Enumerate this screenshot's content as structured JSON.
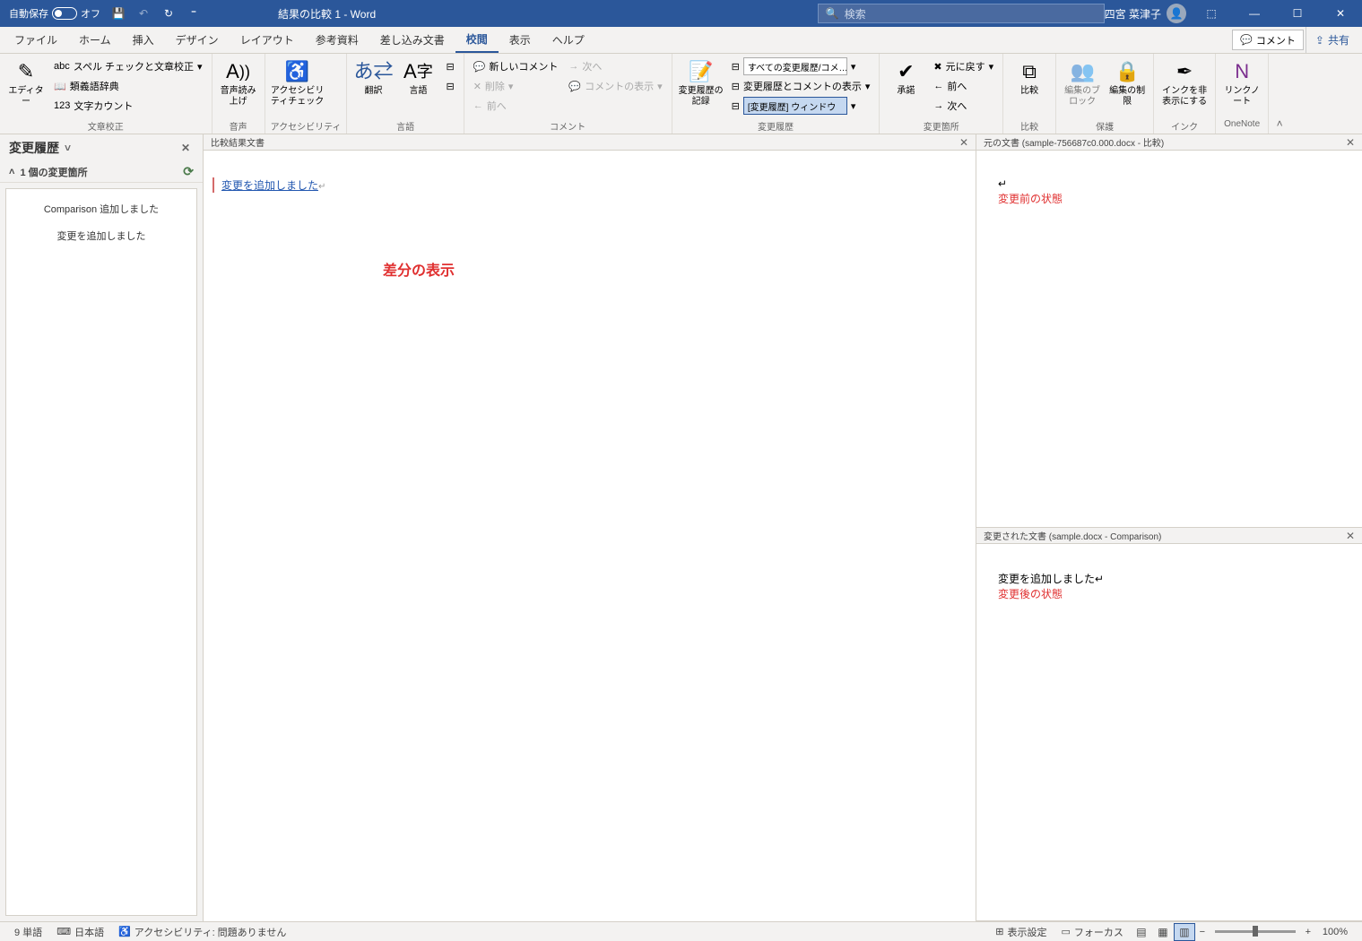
{
  "titlebar": {
    "autosave_label": "自動保存",
    "autosave_state": "オフ",
    "doc_title": "結果の比較 1  -  Word",
    "search_placeholder": "検索",
    "user_name": "四宮 菜津子"
  },
  "tabs": {
    "file": "ファイル",
    "home": "ホーム",
    "insert": "挿入",
    "design": "デザイン",
    "layout": "レイアウト",
    "references": "参考資料",
    "mailings": "差し込み文書",
    "review": "校閲",
    "view": "表示",
    "help": "ヘルプ",
    "comment_btn": "コメント",
    "share": "共有"
  },
  "ribbon": {
    "g_proof": "文章校正",
    "editor": "エディター",
    "spellcheck": "スペル チェックと文章校正",
    "thesaurus": "類義語辞典",
    "wordcount": "文字カウント",
    "g_speech": "音声",
    "readaloud": "音声読み上げ",
    "g_access": "アクセシビリティ",
    "access_check": "アクセシビリティチェック",
    "g_lang": "言語",
    "translate": "翻訳",
    "language": "言語",
    "g_comment": "コメント",
    "new_comment": "新しいコメント",
    "delete": "削除",
    "prev": "前へ",
    "next": "次へ",
    "show_comments": "コメントの表示",
    "g_tracking": "変更履歴",
    "track_changes": "変更履歴の記録",
    "display_mode": "すべての変更履歴/コメ…",
    "show_markup": "変更履歴とコメントの表示",
    "review_pane": "[変更履歴] ウィンドウ",
    "g_changes": "変更箇所",
    "accept": "承諾",
    "revert": "元に戻す",
    "prev2": "前へ",
    "next2": "次へ",
    "g_compare": "比較",
    "compare": "比較",
    "g_protect": "保護",
    "block": "編集のブロック",
    "restrict": "編集の制限",
    "g_ink": "インク",
    "hide_ink": "インクを非表示にする",
    "g_onenote": "OneNote",
    "link_note": "リンクノート"
  },
  "revisions": {
    "title": "変更履歴",
    "count_label": "1 個の変更箇所",
    "item_author": "Comparison 追加しました",
    "item_text": "変更を追加しました"
  },
  "panes": {
    "compare_title": "比較結果文書",
    "original_title": "元の文書 (sample-756687c0.000.docx - 比較)",
    "revised_title": "変更された文書 (sample.docx - Comparison)",
    "inserted_text": "変更を追加しました",
    "revised_body": "変更を追加しました",
    "annot_diff": "差分の表示",
    "annot_before": "変更前の状態",
    "annot_after": "変更後の状態"
  },
  "status": {
    "words": "9 単語",
    "lang": "日本語",
    "access": "アクセシビリティ: 問題ありません",
    "display": "表示設定",
    "focus": "フォーカス",
    "zoom": "100%"
  }
}
